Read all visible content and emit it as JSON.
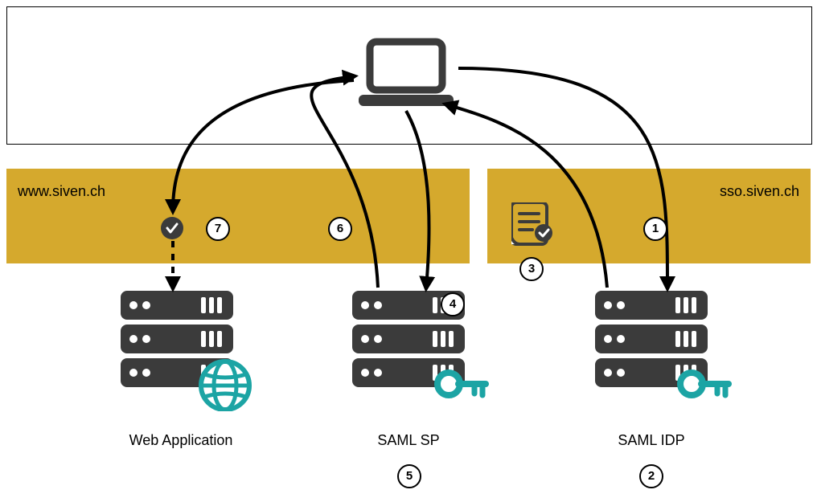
{
  "bands": {
    "left_label": "www.siven.ch",
    "right_label": "sso.siven.ch"
  },
  "nodes": {
    "webapp_label": "Web Application",
    "sp_label": "SAML SP",
    "idp_label": "SAML IDP"
  },
  "steps": {
    "s1": "1",
    "s2": "2",
    "s3": "3",
    "s4": "4",
    "s5": "5",
    "s6": "6",
    "s7": "7"
  },
  "colors": {
    "band": "#d5a92d",
    "accent": "#1ca4a4",
    "dark": "#3b3b3b"
  }
}
